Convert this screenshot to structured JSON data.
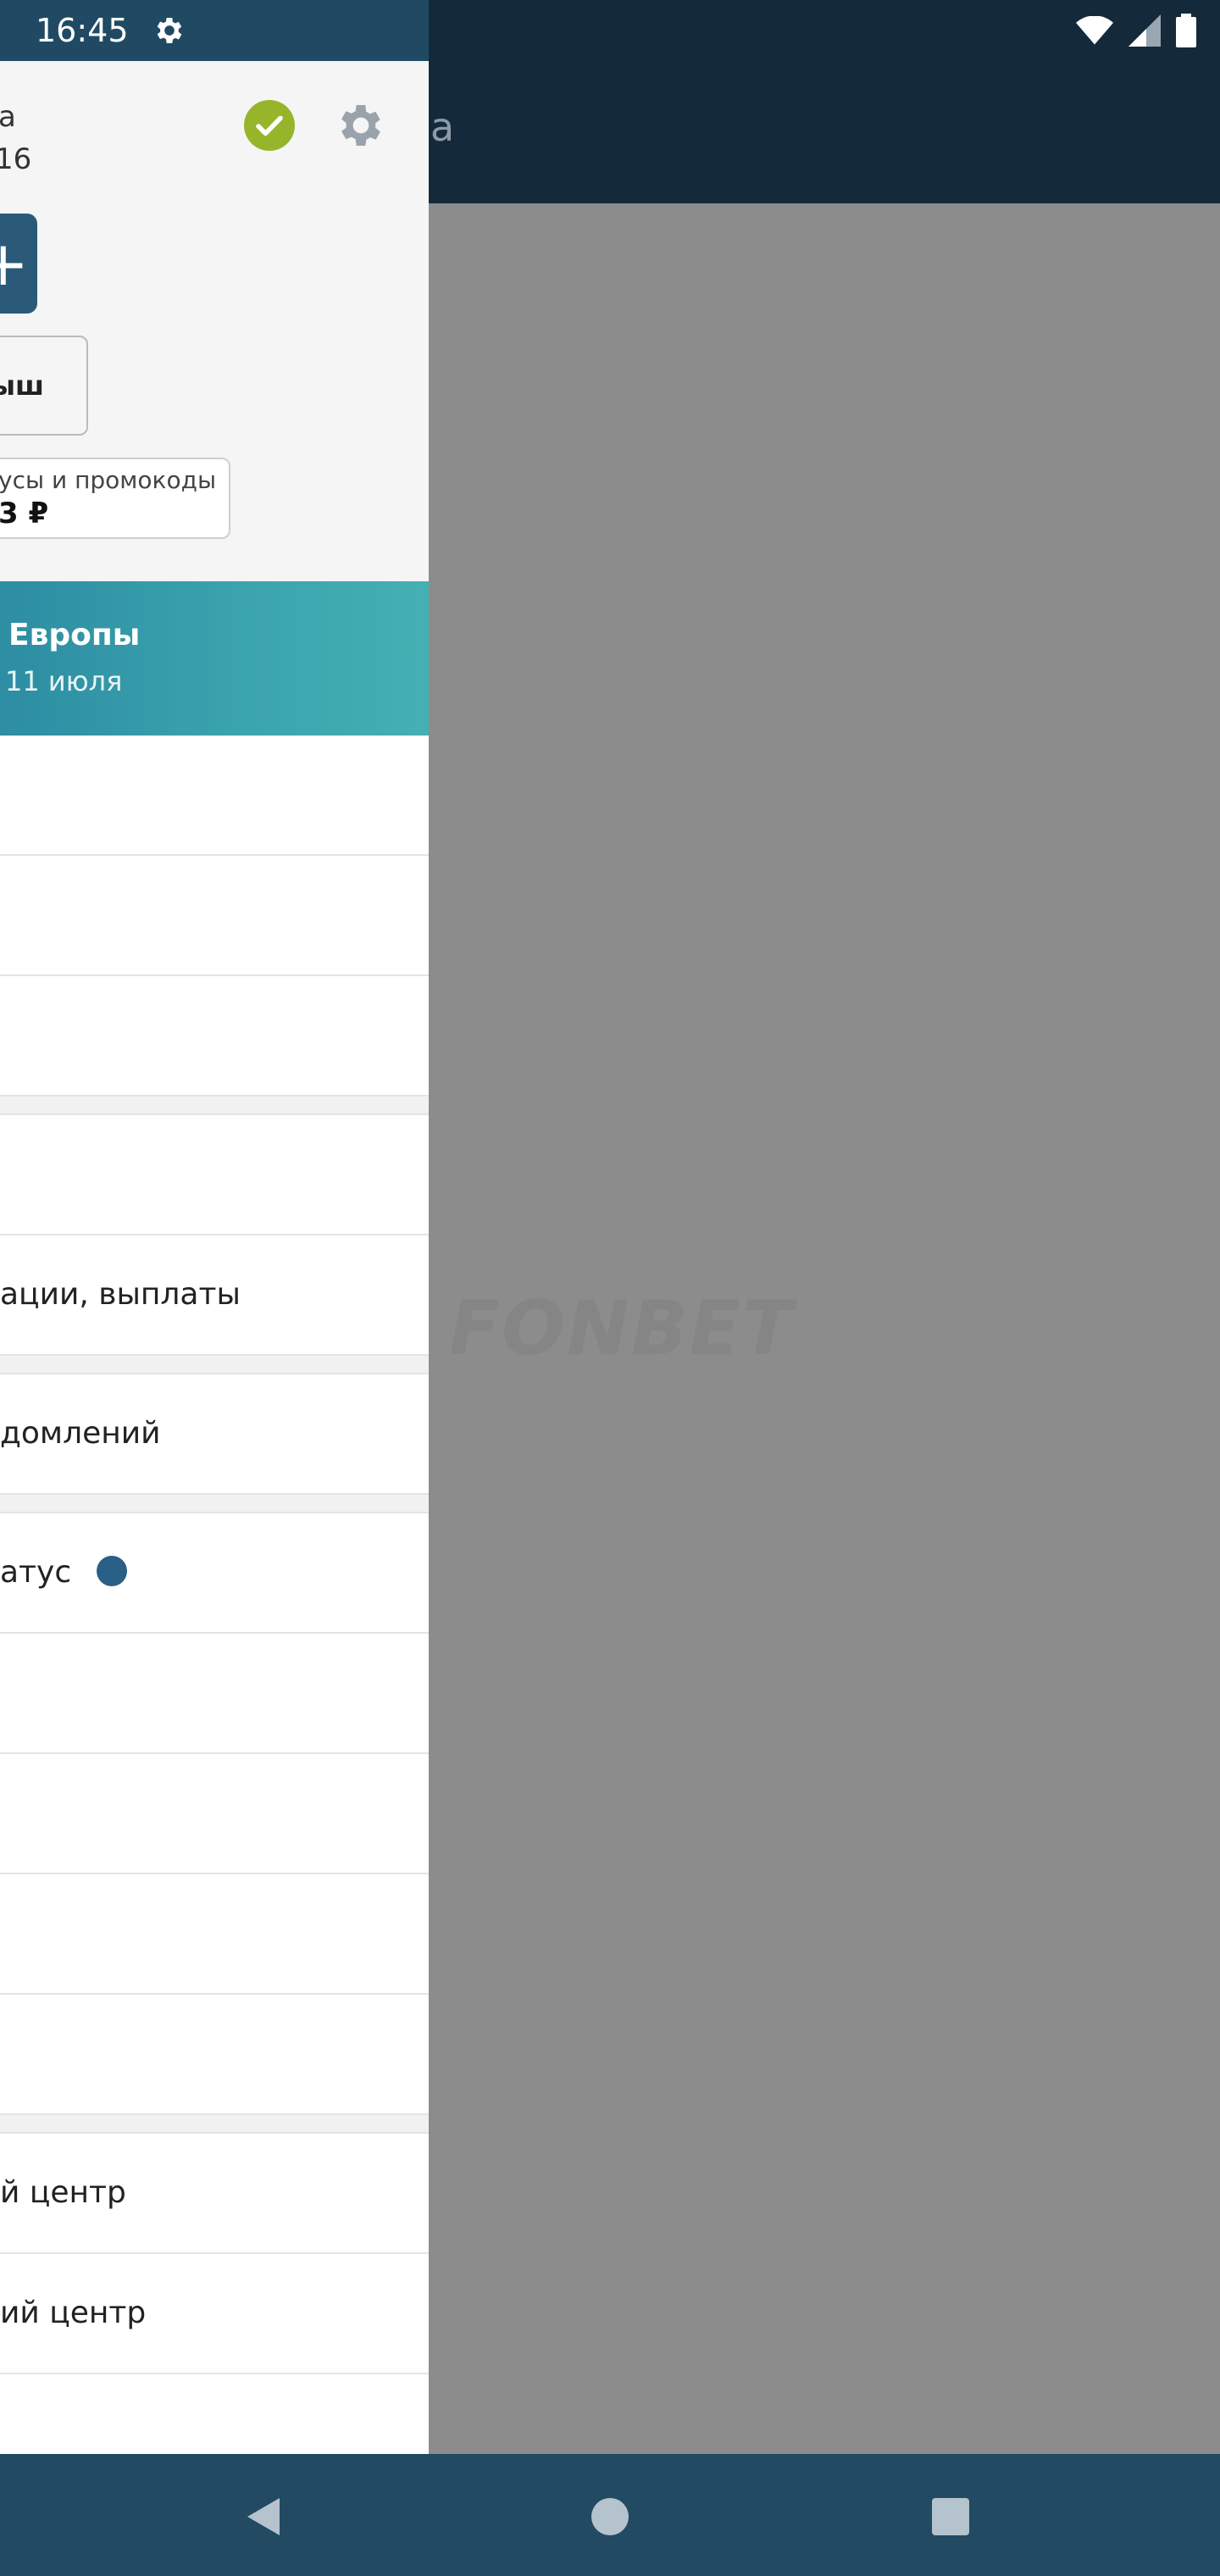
{
  "status_bar": {
    "time": "16:45",
    "icons": [
      "gear-icon",
      "wifi-icon",
      "signal-icon",
      "battery-icon"
    ]
  },
  "header": {
    "title_fragment": "а"
  },
  "profile": {
    "name_fragment": "а",
    "id_fragment": "16",
    "cashout_label": "ыш",
    "bonus_label": "усы и промокоды",
    "bonus_amount": "3 ₽"
  },
  "promo": {
    "title": "Европы",
    "date": "11 июля"
  },
  "menu": {
    "row1": "",
    "row2": "",
    "row3": "",
    "row4": "",
    "row5": "ации, выплаты",
    "row6": "домлений",
    "row7": "атус",
    "row8": "",
    "row9": "",
    "row10": "",
    "row11": "",
    "row12": "й центр",
    "row13": "ий центр"
  },
  "watermark": "FONBET",
  "colors": {
    "status_bar_dark": "#142a3b",
    "drawer_status": "#204a63",
    "overlay": "#8c8c8c",
    "promo_start": "#2d8da3",
    "promo_end": "#45b0b4",
    "verified_green": "#97b52a",
    "status_dot": "#2a5f86",
    "nav_bar": "#224a63"
  }
}
